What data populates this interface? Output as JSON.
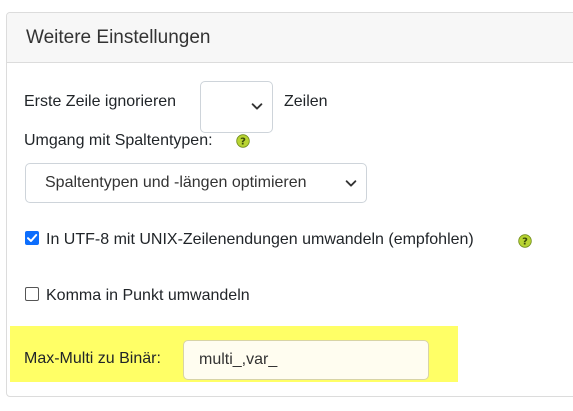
{
  "panel": {
    "title": "Weitere Einstellungen"
  },
  "skip_rows": {
    "label": "Erste Zeile ignorieren",
    "value": "",
    "suffix": "Zeilen"
  },
  "column_types": {
    "label": "Umgang mit Spaltentypen:",
    "selected": "Spaltentypen und -längen optimieren",
    "help_icon": "question-icon"
  },
  "utf8": {
    "label": "In UTF-8 mit UNIX-Zeilenendungen umwandeln (empfohlen)",
    "checked": true,
    "help_icon": "question-icon"
  },
  "comma": {
    "label": "Komma in Punkt umwandeln",
    "checked": false
  },
  "max_multi": {
    "label": "Max-Multi zu Binär:",
    "value": "multi_,var_"
  },
  "colors": {
    "highlight": "#ffff66",
    "checkbox_accent": "#0d6efd",
    "help_icon": "#b8d432"
  }
}
